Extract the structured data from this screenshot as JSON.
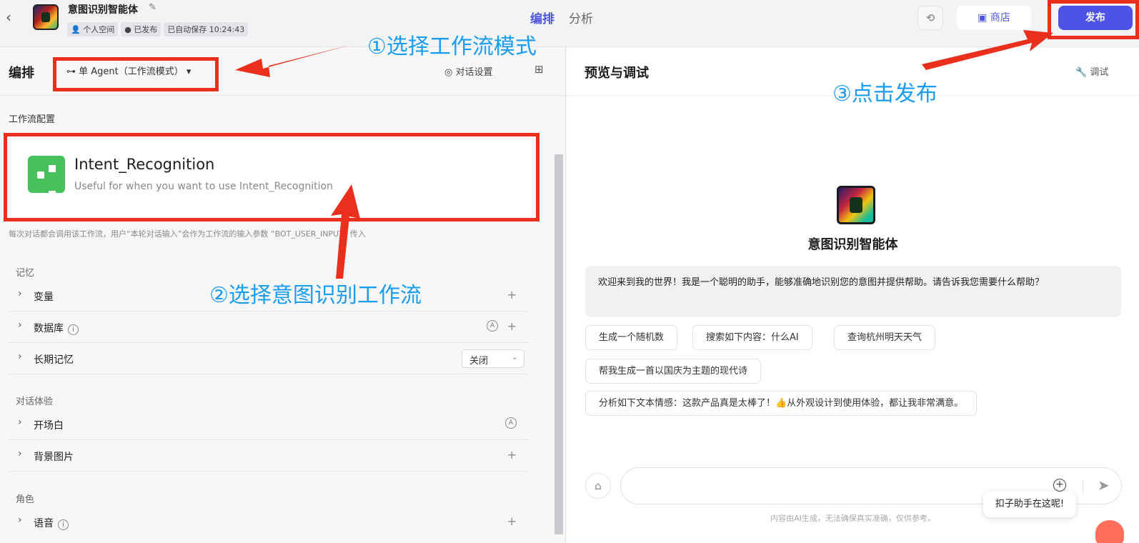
{
  "header": {
    "app_title": "意图识别智能体",
    "chips": [
      "个人空间",
      "已发布",
      "已自动保存 10:24:43"
    ],
    "tabs": [
      "编排",
      "分析"
    ],
    "shop_label": "商店",
    "publish_label": "发布"
  },
  "left": {
    "title": "编排",
    "mode_label": "单 Agent（工作流模式）",
    "dialog_settings_label": "对话设置",
    "workflow_section_label": "工作流配置",
    "workflow_name": "Intent_Recognition",
    "workflow_desc": "Useful for when you want to use Intent_Recognition",
    "workflow_note": "每次对话都会调用该工作流，用户“本轮对话输入”会作为工作流的输入参数 “BOT_USER_INPUT” 传入",
    "memory_label": "记忆",
    "experience_label": "对话体验",
    "role_label": "角色",
    "rows": [
      "变量",
      "数据库",
      "长期记忆",
      "开场白",
      "背景图片",
      "语音"
    ],
    "long_memory_value": "关闭"
  },
  "right": {
    "title": "预览与调试",
    "debug_label": "调试",
    "bot_name": "意图识别智能体",
    "welcome": "欢迎来到我的世界！我是一个聪明的助手，能够准确地识别您的意图并提供帮助。请告诉我您需要什么帮助？",
    "suggestions": [
      "生成一个随机数",
      "搜索如下内容：什么AI",
      "查询杭州明天天气",
      "帮我生成一首以国庆为主题的现代诗",
      "分析如下文本情感：这款产品真是太棒了！👍从外观设计到使用体验，都让我非常满意。"
    ],
    "disclaimer": "内容由AI生成，无法确保真实准确，仅供参考。",
    "helper_bubble": "扣子助手在这呢!"
  },
  "annotations": {
    "step1": "①选择工作流模式",
    "step2": "②选择意图识别工作流",
    "step3": "③点击发布"
  },
  "colors": {
    "accent": "#4d53e8",
    "annotation_red": "#ea2f1d",
    "annotation_blue": "#1a9cf0",
    "workflow_green": "#47c15c"
  }
}
